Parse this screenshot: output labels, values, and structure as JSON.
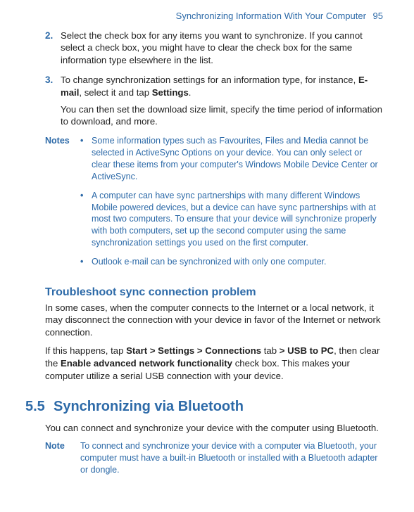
{
  "header": {
    "title": "Synchronizing Information With Your Computer",
    "page": "95"
  },
  "steps": [
    {
      "num": "2.",
      "text": "Select the check box for any items you want to synchronize. If you cannot select a check box, you might have to clear the check box for the same information type elsewhere in the list."
    },
    {
      "num": "3.",
      "text_pre": "To change synchronization settings for an information type, for instance, ",
      "bold1": "E-mail",
      "text_mid": ", select it and tap ",
      "bold2": "Settings",
      "text_post": ".",
      "para2": "You can then set the download size limit, specify the time period of information to download, and more."
    }
  ],
  "notes": {
    "label": "Notes",
    "items": [
      "Some information types such as Favourites, Files and Media cannot be selected in ActiveSync Options on your device. You can only select or clear these items from your computer's Windows Mobile Device Center or ActiveSync.",
      "A computer can have sync partnerships with many different Windows Mobile powered devices, but a device can have sync partnerships with at most two computers. To ensure that your device will synchronize properly with both computers, set up the second computer using the same synchronization settings you used on the first computer.",
      "Outlook e-mail can be synchronized with only one computer."
    ]
  },
  "trouble": {
    "heading": "Troubleshoot sync connection problem",
    "p1": "In some cases, when the computer connects to the Internet or a local network, it may disconnect the connection with your device in favor of the Internet or network connection.",
    "p2_pre": "If this happens, tap ",
    "p2_b1": "Start > Settings > Connections",
    "p2_mid1": " tab ",
    "p2_b2": "> USB to PC",
    "p2_mid2": ", then clear the ",
    "p2_b3": "Enable advanced network functionality",
    "p2_post": " check box. This makes your computer utilize a serial USB connection with your device."
  },
  "section": {
    "num": "5.5",
    "title": "Synchronizing via Bluetooth",
    "intro": "You can connect and synchronize your device with the computer using Bluetooth.",
    "note_label": "Note",
    "note_text": "To connect and synchronize your device with a computer via Bluetooth, your computer must have a built-in Bluetooth or installed with a Bluetooth adapter or dongle."
  }
}
